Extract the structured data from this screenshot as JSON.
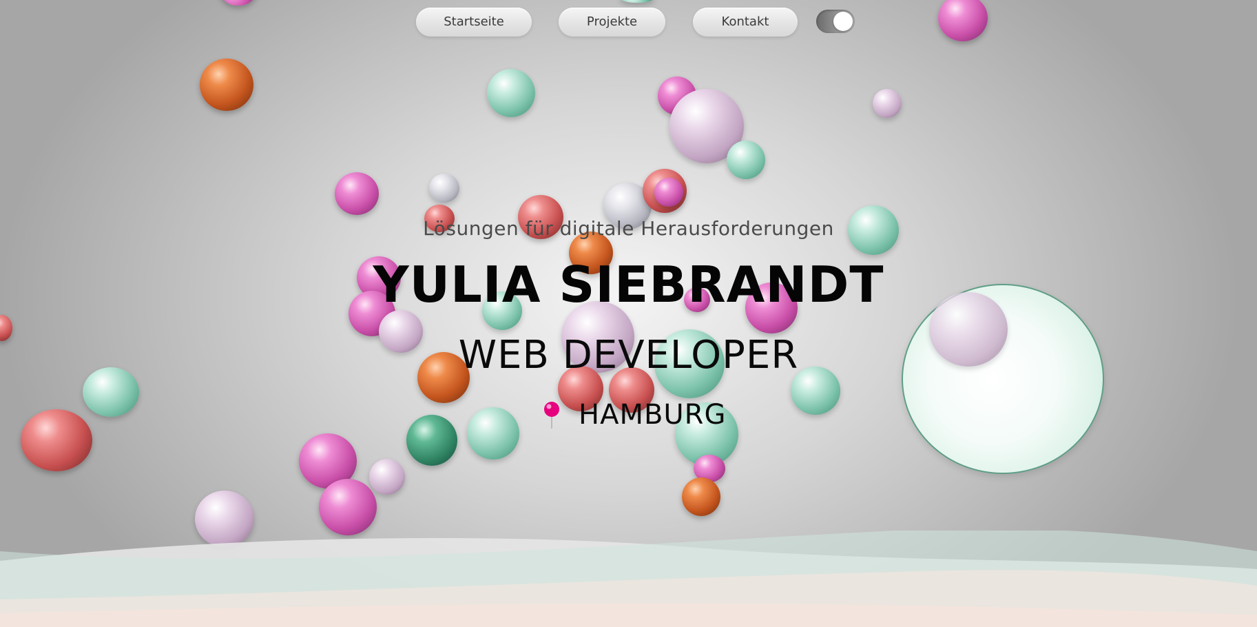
{
  "nav": {
    "home_label": "Startseite",
    "projects_label": "Projekte",
    "contact_label": "Kontakt",
    "theme_toggle_state": "on"
  },
  "hero": {
    "tagline": "Lösungen für digitale Herausforderungen",
    "name": "YULIA SIEBRANDT",
    "role": "WEB DEVELOPER",
    "location": "HAMBURG"
  },
  "colors": {
    "pin": "#e6007e",
    "orange": "#d9692f",
    "teal": "#8ccfb6",
    "pink": "#d65cb6",
    "lilac": "#cdb3cd",
    "red": "#d66262"
  }
}
